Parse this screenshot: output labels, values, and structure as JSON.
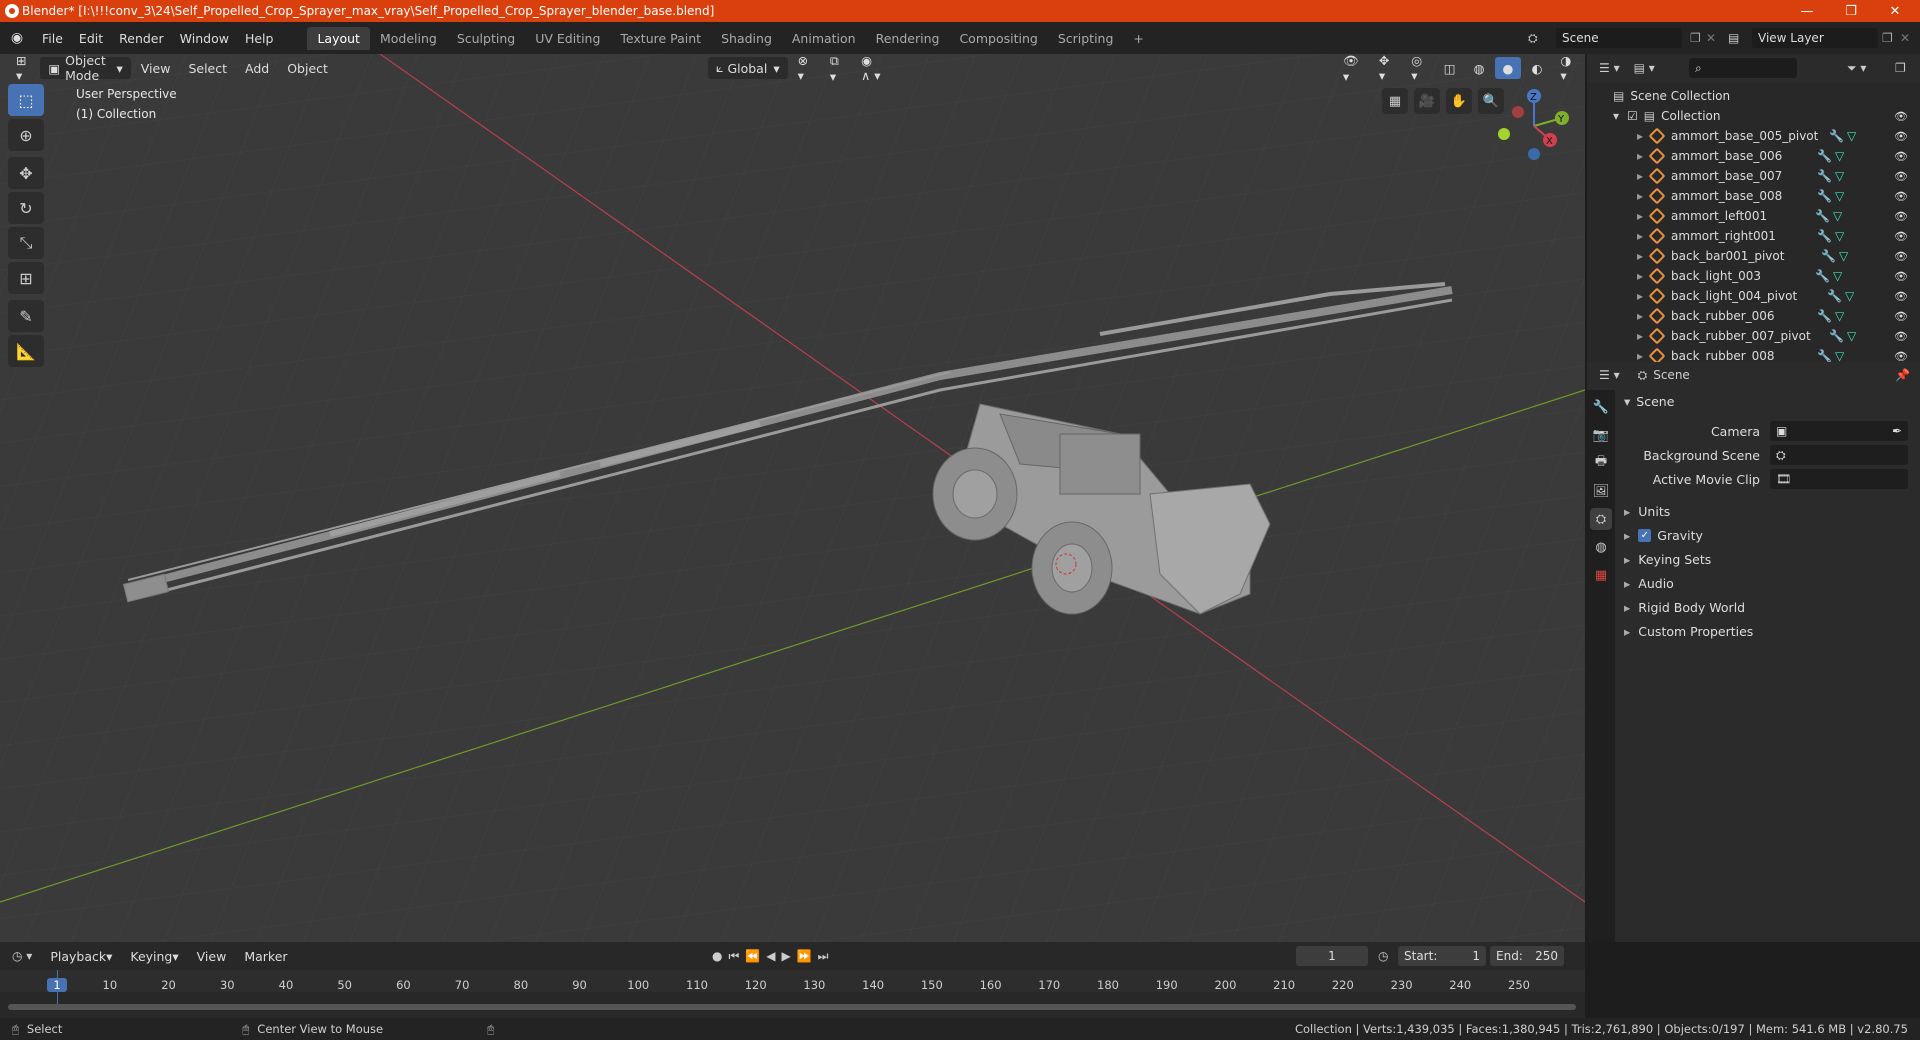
{
  "window": {
    "title": "Blender* [I:\\!!!conv_3\\24\\Self_Propelled_Crop_Sprayer_max_vray\\Self_Propelled_Crop_Sprayer_blender_base.blend]",
    "minimize": "—",
    "maximize": "❐",
    "close": "✕"
  },
  "menu": [
    "File",
    "Edit",
    "Render",
    "Window",
    "Help"
  ],
  "workspaces": [
    "Layout",
    "Modeling",
    "Sculpting",
    "UV Editing",
    "Texture Paint",
    "Shading",
    "Animation",
    "Rendering",
    "Compositing",
    "Scripting"
  ],
  "active_workspace": "Layout",
  "add_workspace": "+",
  "scene_field": "Scene",
  "view_layer_field": "View Layer",
  "viewport_header": {
    "mode": "Object Mode",
    "menus": [
      "View",
      "Select",
      "Add",
      "Object"
    ],
    "orientation": "Global"
  },
  "viewport_overlay": {
    "line1": "User Perspective",
    "line2": "(1) Collection"
  },
  "gizmo": {
    "z": "Z",
    "y": "Y",
    "x": "X"
  },
  "outliner": {
    "root": "Scene Collection",
    "collection": "Collection",
    "items": [
      "ammort_base_005_pivot",
      "ammort_base_006",
      "ammort_base_007",
      "ammort_base_008",
      "ammort_left001",
      "ammort_right001",
      "back_bar001_pivot",
      "back_light_003",
      "back_light_004_pivot",
      "back_rubber_006",
      "back_rubber_007_pivot",
      "back_rubber_008"
    ]
  },
  "properties": {
    "header": "Scene",
    "panel": "Scene",
    "camera_label": "Camera",
    "background_label": "Background Scene",
    "movieclip_label": "Active Movie Clip",
    "sections": [
      "Units",
      "Gravity",
      "Keying Sets",
      "Audio",
      "Rigid Body World",
      "Custom Properties"
    ],
    "gravity_checked": true
  },
  "timeline": {
    "menus": [
      "Playback",
      "Keying",
      "View",
      "Marker"
    ],
    "current_frame": "1",
    "start_label": "Start:",
    "start": "1",
    "end_label": "End:",
    "end": "250",
    "ticks": [
      "1",
      "10",
      "20",
      "30",
      "40",
      "50",
      "60",
      "70",
      "80",
      "90",
      "100",
      "110",
      "120",
      "130",
      "140",
      "150",
      "160",
      "170",
      "180",
      "190",
      "200",
      "210",
      "220",
      "230",
      "240",
      "250"
    ]
  },
  "status": {
    "left1": "Select",
    "left2": "Center View to Mouse",
    "right": "Collection | Verts:1,439,035 | Faces:1,380,945 | Tris:2,761,890 | Objects:0/197 | Mem: 541.6 MB | v2.80.75"
  },
  "colors": {
    "accent": "#4772b3",
    "titlebar": "#d9400e",
    "x_axis": "#c9404f",
    "y_axis": "#7ea82c"
  }
}
